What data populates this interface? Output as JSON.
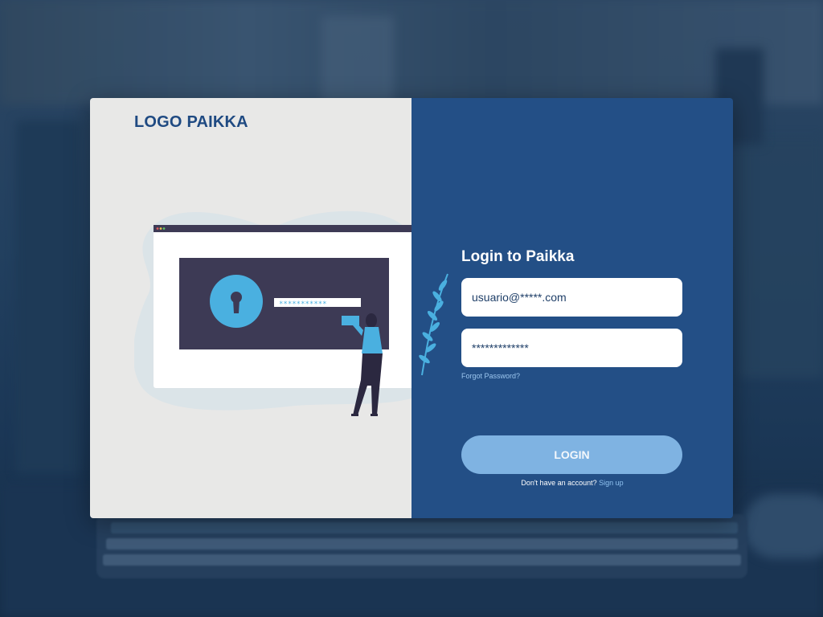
{
  "brand": {
    "logo_text": "LOGO PAIKKA"
  },
  "login": {
    "title": "Login to Paikka",
    "email_value": "usuario@*****.com",
    "password_value": "*************",
    "forgot_label": "Forgot Password?",
    "login_button_label": "LOGIN",
    "signup_prompt": "Don't have an account?",
    "signup_link": "Sign up"
  },
  "illustration": {
    "masked_password": "***********",
    "icons": [
      "keyhole-icon",
      "laurel-branch-icon",
      "person-figure"
    ]
  },
  "colors": {
    "panel_blue": "#234f86",
    "panel_gray": "#e8e8e7",
    "button_light_blue": "#7fb3e2",
    "accent_cyan": "#4ab0e0",
    "screen_dark": "#3d3a55"
  }
}
